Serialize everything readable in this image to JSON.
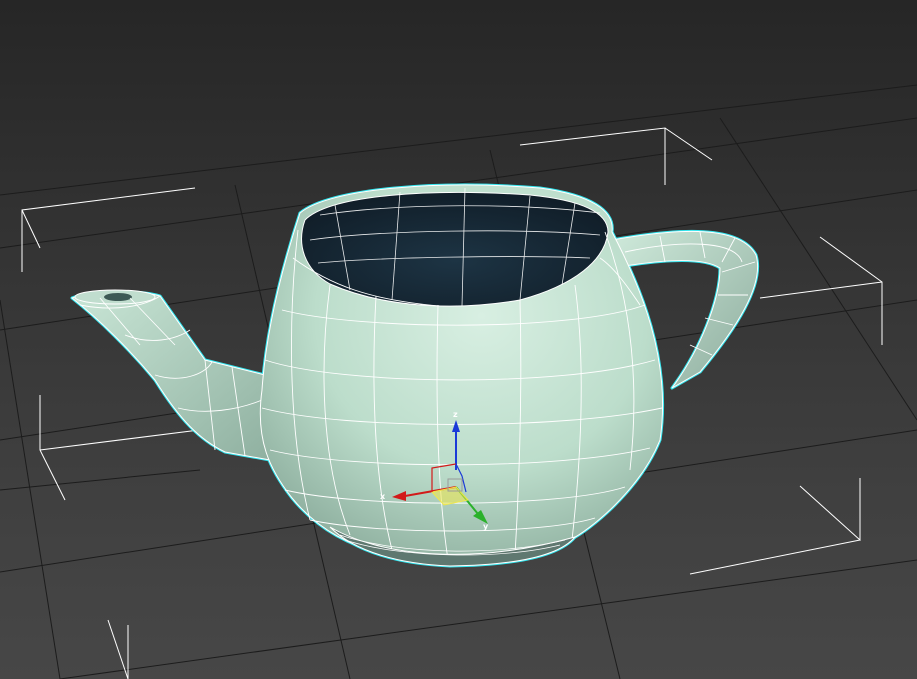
{
  "viewport": {
    "background_top": "#262626",
    "background_bottom": "#474747",
    "grid_color": "#1c1c1c",
    "selection_bracket_color": "#ffffff"
  },
  "object": {
    "name_visible": false,
    "mesh_fill": "#bfe0cf",
    "wire_color": "#ffffff",
    "selection_outline_color": "#35e6ee",
    "interior_color": "#1f3240"
  },
  "gizmo": {
    "axes": {
      "x_label": "x",
      "y_label": "y",
      "z_label": "z"
    },
    "colors": {
      "x": "#d21a1a",
      "y": "#2bb12b",
      "z": "#1a3ad8",
      "plane": "#f0e84a"
    }
  }
}
